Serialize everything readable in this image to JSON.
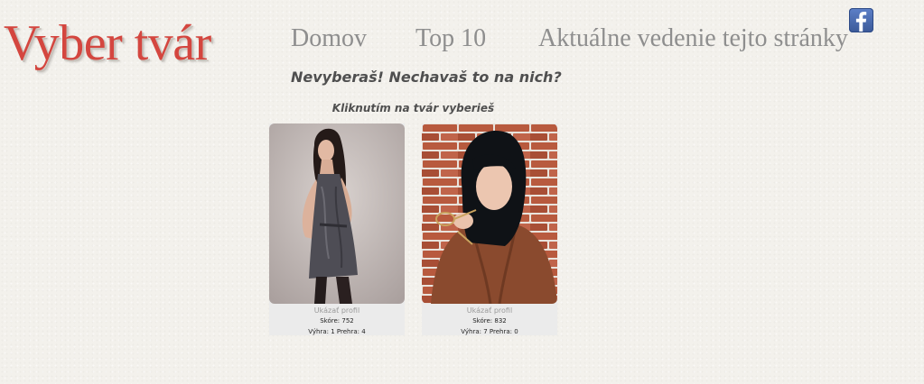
{
  "site": {
    "logo": "Vyber tvár",
    "accent_color": "#d4463f"
  },
  "nav": {
    "home": "Domov",
    "top": "Top 10",
    "news": "Aktuálne vedenie tejto stránky",
    "facebook_icon": "facebook-icon"
  },
  "main": {
    "tagline": "Nevyberaš! Nechavaš to na nich?",
    "instruction": "Kliknutím na tvár vyberieš",
    "candidates": [
      {
        "profile_link": "Ukázať profil",
        "score": "Skóre: 752",
        "record": "Výhra: 1 Prehra: 4"
      },
      {
        "profile_link": "Ukázať profil",
        "score": "Skóre: 832",
        "record": "Výhra: 7 Prehra: 0"
      }
    ]
  }
}
